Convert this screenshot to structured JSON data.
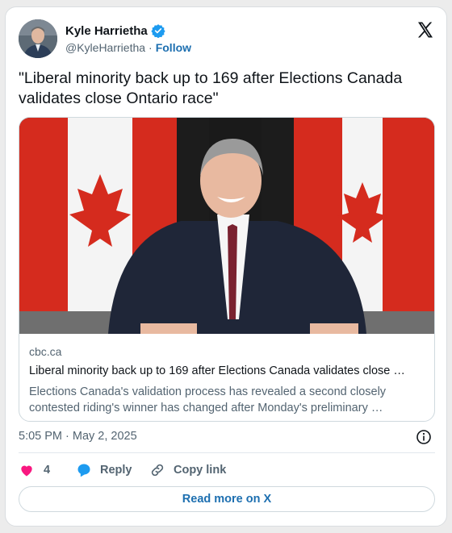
{
  "author": {
    "name": "Kyle Harrietha",
    "handle": "@KyleHarrietha",
    "separator": "·",
    "follow_label": "Follow",
    "verified": true
  },
  "tweet": {
    "text": "\"Liberal minority back up to 169 after Elections Canada validates close Ontario race\""
  },
  "link_card": {
    "domain": "cbc.ca",
    "title": "Liberal minority back up to 169 after Elections Canada validates close …",
    "description": "Elections Canada's validation process has revealed a second closely contested riding's winner has changed after Monday's preliminary …"
  },
  "timestamp": "5:05 PM · May 2, 2025",
  "actions": {
    "like_count": "4",
    "reply_label": "Reply",
    "copy_link_label": "Copy link"
  },
  "read_more_label": "Read more on X",
  "colors": {
    "link_blue": "#1d6fb0",
    "verified_blue": "#1d9bf0",
    "like_pink": "#f91880",
    "muted_text": "#536471",
    "flag_red": "#d52b1e"
  }
}
